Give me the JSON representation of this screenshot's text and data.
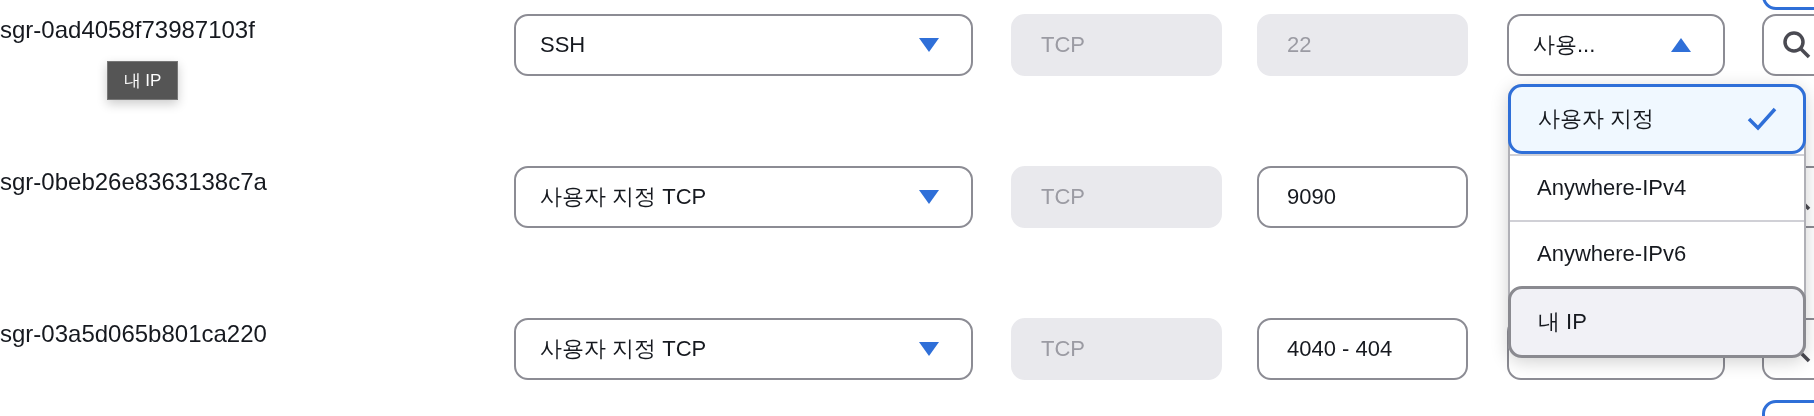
{
  "rows": [
    {
      "id": "sgr-0ad4058f73987103f",
      "type": {
        "value": "SSH"
      },
      "protocol": {
        "value": "TCP",
        "disabled": true
      },
      "port_range": {
        "value": "22",
        "disabled": true
      },
      "source": {
        "value": "사용...",
        "expanded": true
      }
    },
    {
      "id": "sgr-0beb26e8363138c7a",
      "type": {
        "value": "사용자 지정 TCP"
      },
      "protocol": {
        "value": "TCP",
        "disabled": true
      },
      "port_range": {
        "value": "9090",
        "disabled": false
      }
    },
    {
      "id": "sgr-03a5d065b801ca220",
      "type": {
        "value": "사용자 지정 TCP"
      },
      "protocol": {
        "value": "TCP",
        "disabled": true
      },
      "port_range": {
        "value": "4040 - 404",
        "disabled": false
      },
      "source": {
        "expanded": false
      }
    }
  ],
  "tooltip": {
    "text": "내 IP"
  },
  "source_menu": {
    "options": [
      {
        "label": "사용자 지정",
        "selected": true,
        "hovered": false
      },
      {
        "label": "Anywhere-IPv4",
        "selected": false,
        "hovered": false
      },
      {
        "label": "Anywhere-IPv6",
        "selected": false,
        "hovered": false
      },
      {
        "label": "내 IP",
        "selected": false,
        "hovered": true
      }
    ]
  }
}
